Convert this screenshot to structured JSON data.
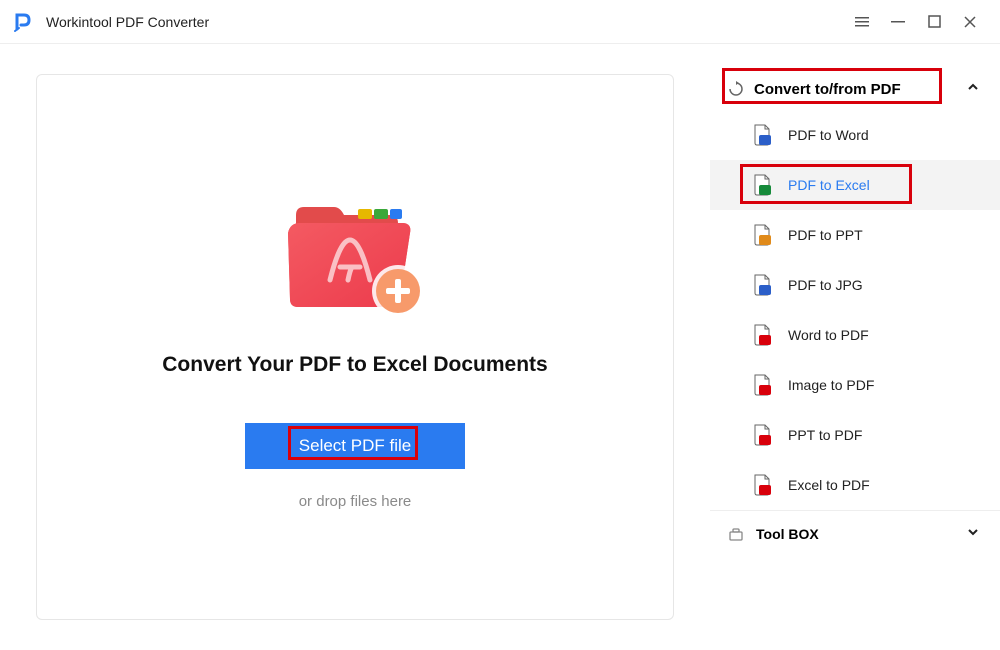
{
  "titlebar": {
    "title": "Workintool PDF Converter"
  },
  "main": {
    "heading": "Convert Your PDF to Excel Documents",
    "select_label": "Select PDF file",
    "drop_hint": "or drop files here"
  },
  "sidebar": {
    "section_label": "Convert to/from PDF",
    "items": [
      {
        "label": "PDF to Word",
        "badge_color": "#2b5ec8",
        "active": false
      },
      {
        "label": "PDF to Excel",
        "badge_color": "#168a3a",
        "active": true
      },
      {
        "label": "PDF to PPT",
        "badge_color": "#e08a1a",
        "active": false
      },
      {
        "label": "PDF to JPG",
        "badge_color": "#2b5ec8",
        "active": false
      },
      {
        "label": "Word to PDF",
        "badge_color": "#d8000b",
        "active": false
      },
      {
        "label": "Image to PDF",
        "badge_color": "#d8000b",
        "active": false
      },
      {
        "label": "PPT to PDF",
        "badge_color": "#d8000b",
        "active": false
      },
      {
        "label": "Excel to PDF",
        "badge_color": "#d8000b",
        "active": false
      }
    ],
    "toolbox_label": "Tool BOX"
  }
}
